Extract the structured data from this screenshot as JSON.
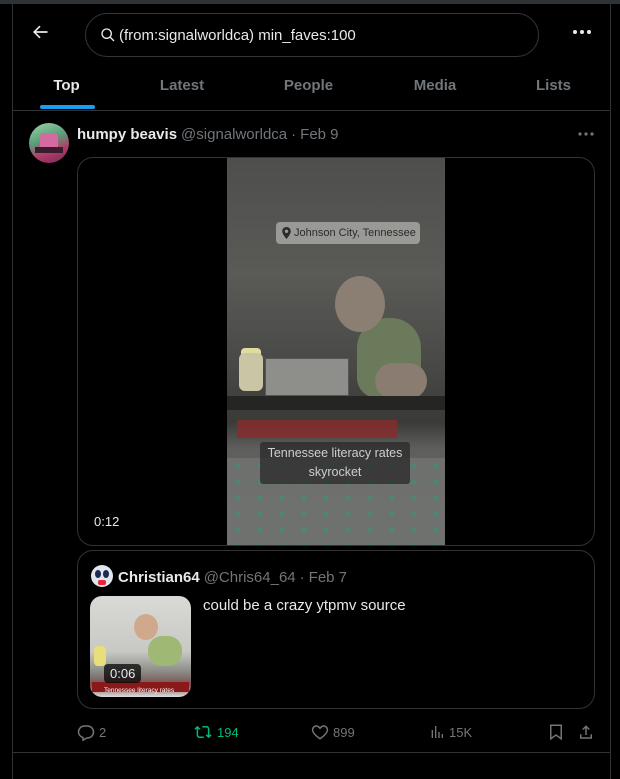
{
  "header": {
    "back_icon": "arrow-left-icon",
    "search": {
      "value": "(from:signalworldca) min_faves:100",
      "icon": "search-icon"
    },
    "more_icon": "more-horizontal-icon"
  },
  "tabs": [
    {
      "label": "Top",
      "active": true
    },
    {
      "label": "Latest",
      "active": false
    },
    {
      "label": "People",
      "active": false
    },
    {
      "label": "Media",
      "active": false
    },
    {
      "label": "Lists",
      "active": false
    }
  ],
  "colors": {
    "accent": "#1d9bf0",
    "retweeted": "#00ba7c",
    "muted": "#71767b",
    "text": "#e7e9ea",
    "border": "#2f3336"
  },
  "post": {
    "author": {
      "name": "humpy beavis",
      "handle": "@signalworldca",
      "separator": "·",
      "date": "Feb 9"
    },
    "video": {
      "location_tag": "Johnson City, Tennessee",
      "caption_line1": "Tennessee literacy rates",
      "caption_line2": "skyrocket",
      "duration": "0:12"
    },
    "quote": {
      "author": {
        "name": "Christian64",
        "handle": "@Chris64_64",
        "separator": "·",
        "date": "Feb 7"
      },
      "thumb_duration": "0:06",
      "thumb_caption": "Tennessee literacy rates",
      "text": "could be a crazy ytpmv source"
    },
    "stats": {
      "replies": "2",
      "reposts": "194",
      "likes": "899",
      "views": "15K"
    }
  }
}
